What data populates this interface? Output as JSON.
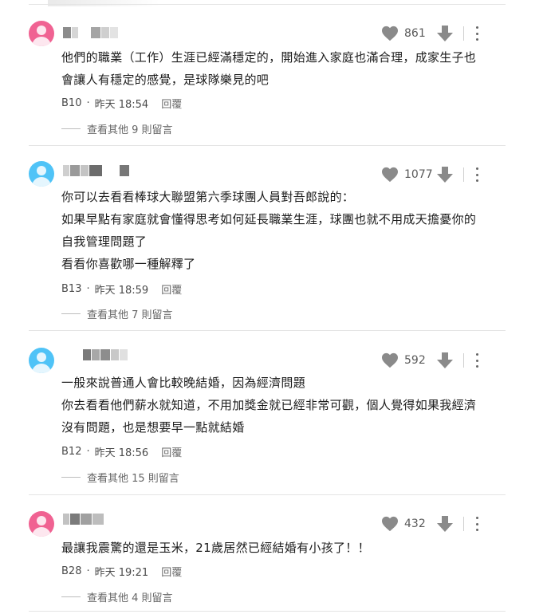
{
  "colors": {
    "avatar_pink": "#f06292",
    "avatar_blue": "#4fc3f7",
    "icon_gray": "#8a8a8a",
    "separator": "#e4e4e4"
  },
  "icons": {
    "like": "heart-icon",
    "dislike": "thumb-down-arrow-icon",
    "menu": "more-vertical-icon"
  },
  "comments": [
    {
      "avatar": "pink",
      "likes": "861",
      "lines": [
        "他們的職業（工作）生涯已經滿穩定的，開始進入家庭也滿合理，成家生子也",
        "會讓人有穩定的感覺，是球隊樂見的吧"
      ],
      "floor": "B10",
      "time": "昨天 18:54",
      "reply": "回覆",
      "more": "查看其他 9 則留言"
    },
    {
      "avatar": "blue",
      "likes": "1077",
      "lines": [
        "你可以去看看棒球大聯盟第六季球團人員對吾郎說的：",
        "如果早點有家庭就會懂得思考如何延長職業生涯，球團也就不用成天擔憂你的",
        "自我管理問題了",
        "看看你喜歡哪一種解釋了"
      ],
      "floor": "B13",
      "time": "昨天 18:59",
      "reply": "回覆",
      "more": "查看其他 7 則留言"
    },
    {
      "avatar": "blue",
      "likes": "592",
      "lines": [
        "一般來說普通人會比較晚結婚，因為經濟問題",
        "你去看看他們薪水就知道，不用加獎金就已經非常可觀，個人覺得如果我經濟",
        "沒有問題，也是想要早一點就結婚"
      ],
      "floor": "B12",
      "time": "昨天 18:56",
      "reply": "回覆",
      "more": "查看其他 15 則留言"
    },
    {
      "avatar": "pink",
      "likes": "432",
      "lines": [
        "最讓我震驚的還是玉米，21歲居然已經結婚有小孩了！！"
      ],
      "floor": "B28",
      "time": "昨天 19:21",
      "reply": "回覆",
      "more": "查看其他 4 則留言"
    }
  ]
}
